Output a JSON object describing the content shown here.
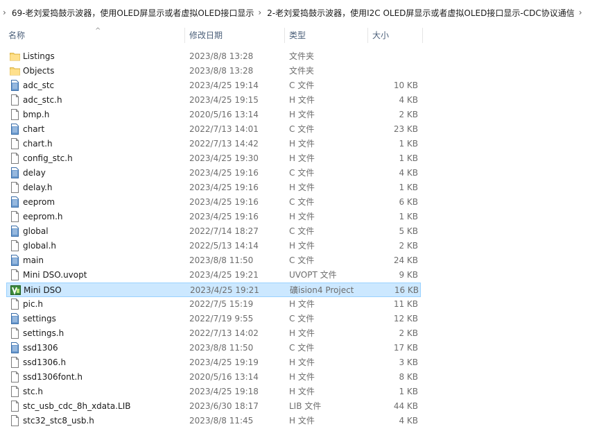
{
  "breadcrumb": {
    "items": [
      "69-老刘爱捣鼓示波器，使用OLED屏显示或者虚拟OLED接口显示",
      "2-老刘爱捣鼓示波器，使用I2C OLED屏显示或者虚拟OLED接口显示-CDC协议通信"
    ]
  },
  "columns": {
    "name": "名称",
    "date": "修改日期",
    "type": "类型",
    "size": "大小"
  },
  "files": [
    {
      "name": "Listings",
      "date": "2023/8/8 13:28",
      "type": "文件夹",
      "size": "",
      "icon": "folder-icon"
    },
    {
      "name": "Objects",
      "date": "2023/8/8 13:28",
      "type": "文件夹",
      "size": "",
      "icon": "folder-icon"
    },
    {
      "name": "adc_stc",
      "date": "2023/4/25 19:14",
      "type": "C 文件",
      "size": "10 KB",
      "icon": "c-file-icon"
    },
    {
      "name": "adc_stc.h",
      "date": "2023/4/25 19:15",
      "type": "H 文件",
      "size": "4 KB",
      "icon": "file-icon"
    },
    {
      "name": "bmp.h",
      "date": "2020/5/16 13:14",
      "type": "H 文件",
      "size": "2 KB",
      "icon": "file-icon"
    },
    {
      "name": "chart",
      "date": "2022/7/13 14:01",
      "type": "C 文件",
      "size": "23 KB",
      "icon": "c-file-icon"
    },
    {
      "name": "chart.h",
      "date": "2022/7/13 14:42",
      "type": "H 文件",
      "size": "1 KB",
      "icon": "file-icon"
    },
    {
      "name": "config_stc.h",
      "date": "2023/4/25 19:30",
      "type": "H 文件",
      "size": "1 KB",
      "icon": "file-icon"
    },
    {
      "name": "delay",
      "date": "2023/4/25 19:16",
      "type": "C 文件",
      "size": "4 KB",
      "icon": "c-file-icon"
    },
    {
      "name": "delay.h",
      "date": "2023/4/25 19:16",
      "type": "H 文件",
      "size": "1 KB",
      "icon": "file-icon"
    },
    {
      "name": "eeprom",
      "date": "2023/4/25 19:16",
      "type": "C 文件",
      "size": "6 KB",
      "icon": "c-file-icon"
    },
    {
      "name": "eeprom.h",
      "date": "2023/4/25 19:16",
      "type": "H 文件",
      "size": "1 KB",
      "icon": "file-icon"
    },
    {
      "name": "global",
      "date": "2022/7/14 18:27",
      "type": "C 文件",
      "size": "5 KB",
      "icon": "c-file-icon"
    },
    {
      "name": "global.h",
      "date": "2022/5/13 14:14",
      "type": "H 文件",
      "size": "2 KB",
      "icon": "file-icon"
    },
    {
      "name": "main",
      "date": "2023/8/8 11:50",
      "type": "C 文件",
      "size": "24 KB",
      "icon": "c-file-icon"
    },
    {
      "name": "Mini DSO.uvopt",
      "date": "2023/4/25 19:21",
      "type": "UVOPT 文件",
      "size": "9 KB",
      "icon": "file-icon"
    },
    {
      "name": "Mini DSO",
      "date": "2023/4/25 19:21",
      "type": "礦ision4 Project",
      "size": "16 KB",
      "icon": "keil-project-icon",
      "selected": true
    },
    {
      "name": "pic.h",
      "date": "2022/7/5 15:19",
      "type": "H 文件",
      "size": "11 KB",
      "icon": "file-icon"
    },
    {
      "name": "settings",
      "date": "2022/7/19 9:55",
      "type": "C 文件",
      "size": "12 KB",
      "icon": "c-file-icon"
    },
    {
      "name": "settings.h",
      "date": "2022/7/13 14:02",
      "type": "H 文件",
      "size": "2 KB",
      "icon": "file-icon"
    },
    {
      "name": "ssd1306",
      "date": "2023/8/8 11:50",
      "type": "C 文件",
      "size": "17 KB",
      "icon": "c-file-icon"
    },
    {
      "name": "ssd1306.h",
      "date": "2023/4/25 19:19",
      "type": "H 文件",
      "size": "3 KB",
      "icon": "file-icon"
    },
    {
      "name": "ssd1306font.h",
      "date": "2020/5/16 13:14",
      "type": "H 文件",
      "size": "8 KB",
      "icon": "file-icon"
    },
    {
      "name": "stc.h",
      "date": "2023/4/25 19:18",
      "type": "H 文件",
      "size": "1 KB",
      "icon": "file-icon"
    },
    {
      "name": "stc_usb_cdc_8h_xdata.LIB",
      "date": "2023/6/30 18:17",
      "type": "LIB 文件",
      "size": "44 KB",
      "icon": "file-icon"
    },
    {
      "name": "stc32_stc8_usb.h",
      "date": "2023/8/8 11:45",
      "type": "H 文件",
      "size": "4 KB",
      "icon": "file-icon"
    }
  ]
}
